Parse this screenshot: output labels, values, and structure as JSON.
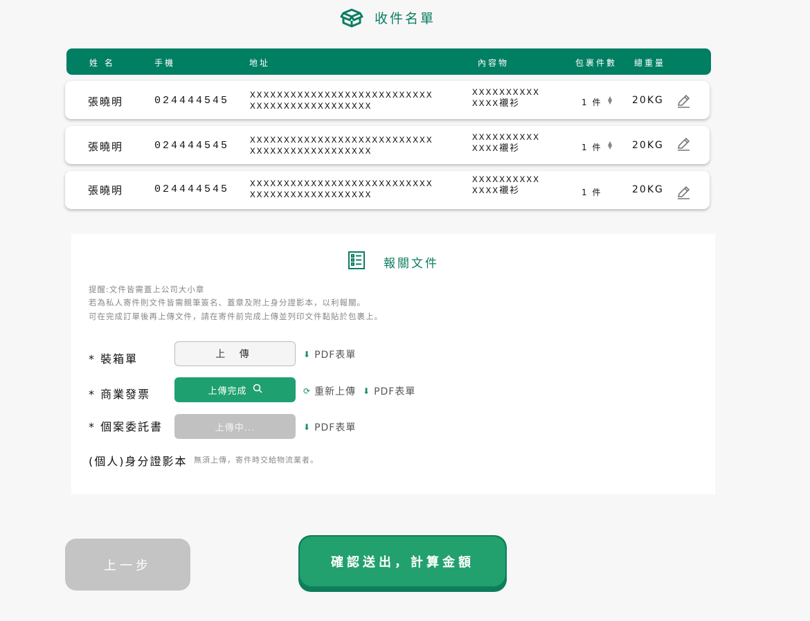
{
  "header": {
    "title": "收件名單",
    "icon": "package-box-icon"
  },
  "table": {
    "columns": [
      "姓 名",
      "手機",
      "地址",
      "內容物",
      "包裹件數",
      "總重量"
    ],
    "rows": [
      {
        "name": "張曉明",
        "phone": "024444545",
        "address_line1": "XXXXXXXXXXXXXXXXXXXXXXXXXXX",
        "address_line2": "XXXXXXXXXXXXXXXXXX",
        "item_line1": "XXXXXXXXXX",
        "item_line2": "XXXX襯衫",
        "qty": "1 件",
        "weight": "20KG"
      },
      {
        "name": "張曉明",
        "phone": "024444545",
        "address_line1": "XXXXXXXXXXXXXXXXXXXXXXXXXXX",
        "address_line2": "XXXXXXXXXXXXXXXXXX",
        "item_line1": "XXXXXXXXXX",
        "item_line2": "XXXX襯衫",
        "qty": "1 件",
        "weight": "20KG"
      },
      {
        "name": "張曉明",
        "phone": "024444545",
        "address_line1": "XXXXXXXXXXXXXXXXXXXXXXXXXXX",
        "address_line2": "XXXXXXXXXXXXXXXXXX",
        "item_line1": "XXXXXXXXXX",
        "item_line2": "XXXX襯衫",
        "qty": "1 件",
        "weight": "20KG"
      }
    ]
  },
  "customs": {
    "title": "報關文件",
    "notes": [
      "提醒:文件皆需蓋上公司大小章",
      "若為私人寄件則文件皆需親筆簽名、蓋章及附上身分證影本，以利報關。",
      "可在完成訂單後再上傳文件，請在寄件前完成上傳並列印文件黏貼於包裹上。"
    ],
    "packing_list": {
      "label": "* 裝箱單",
      "button": "上 傳",
      "pdf": "PDF表單"
    },
    "invoice": {
      "label": "* 商業發票",
      "button": "上傳完成",
      "reupload": "重新上傳",
      "pdf": "PDF表單"
    },
    "consignment": {
      "label": "* 個案委託書",
      "button": "上傳中...",
      "pdf": "PDF表單"
    },
    "id_copy": {
      "label": "(個人)身分證影本",
      "note": "無須上傳，寄件時交給物流業者。"
    }
  },
  "actions": {
    "prev": "上一步",
    "submit": "確認送出，計算金額"
  },
  "colors": {
    "brand": "#007f63",
    "accent": "#22a06e",
    "disabled": "#c4c4c4"
  }
}
